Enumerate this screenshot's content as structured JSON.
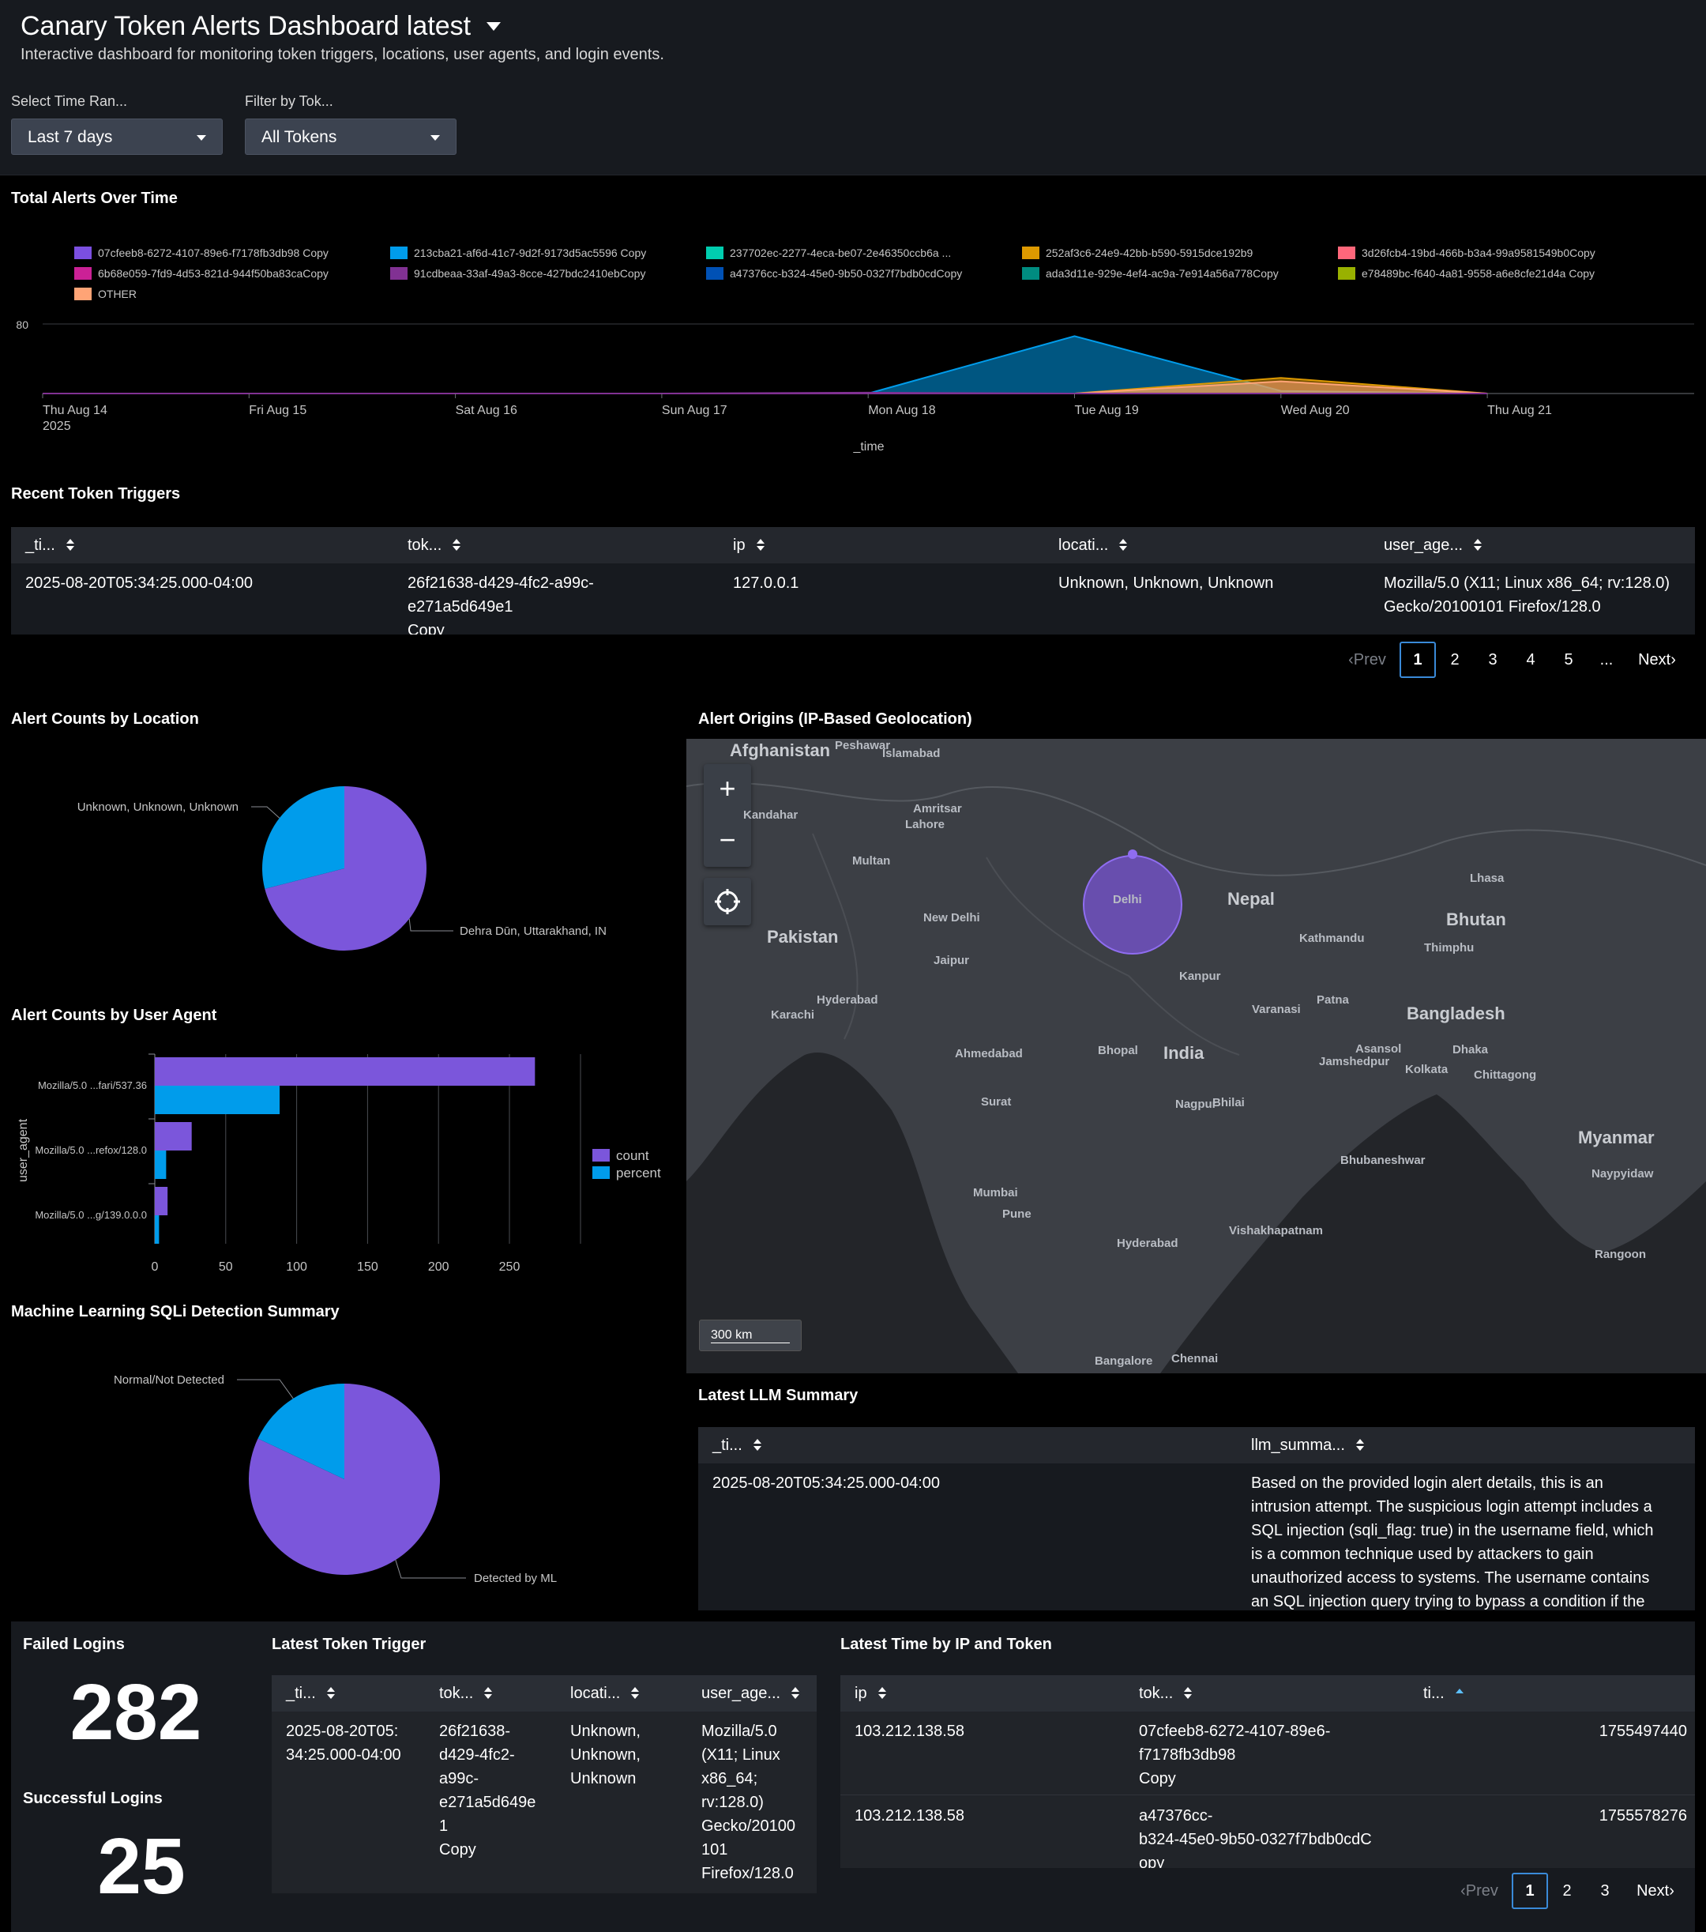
{
  "header": {
    "title": "Canary Token Alerts Dashboard latest",
    "subtitle": "Interactive dashboard for monitoring token triggers, locations, user agents, and login events.",
    "inputs": [
      {
        "label": "Select Time Ran...",
        "value": "Last 7 days"
      },
      {
        "label": "Filter by Tok...",
        "value": "All Tokens"
      }
    ]
  },
  "alerts_over_time": {
    "title": "Total Alerts Over Time",
    "legend": [
      {
        "name": "07cfeeb8-6272-4107-89e6-f7178fb3db98 Copy",
        "color": "#7b4fe0"
      },
      {
        "name": "213cba21-af6d-41c7-9d2f-9173d5ac5596 Copy",
        "color": "#009ceb"
      },
      {
        "name": "237702ec-2277-4eca-be07-2e46350ccb6a ...",
        "color": "#00cdaf"
      },
      {
        "name": "252af3c6-24e9-42bb-b590-5915dce192b9",
        "color": "#dd9900"
      },
      {
        "name": "3d26fcb4-19bd-466b-b3a4-99a9581549b0Copy",
        "color": "#ff677b"
      },
      {
        "name": "6b68e059-7fd9-4d53-821d-944f50ba83caCopy",
        "color": "#cb2196"
      },
      {
        "name": "91cdbeaa-33af-49a3-8cce-427bdc2410ebCopy",
        "color": "#813193"
      },
      {
        "name": "a47376cc-b324-45e0-9b50-0327f7bdb0cdCopy",
        "color": "#0051b5"
      },
      {
        "name": "ada3d11e-929e-4ef4-ac9a-7e914a56a778Copy",
        "color": "#008c80"
      },
      {
        "name": "e78489bc-f640-4a81-9558-a6e8cfe21d4a Copy",
        "color": "#99b100"
      },
      {
        "name": "OTHER",
        "color": "#ffa476"
      }
    ],
    "y_tick": "80",
    "x_ticks": [
      "Thu Aug 14",
      "Fri Aug 15",
      "Sat Aug 16",
      "Sun Aug 17",
      "Mon Aug 18",
      "Tue Aug 19",
      "Wed Aug 20",
      "Thu Aug 21"
    ],
    "x_year": "2025",
    "xlabel": "_time"
  },
  "chart_data": [
    {
      "type": "area",
      "title": "Total Alerts Over Time",
      "xlabel": "_time",
      "x": [
        "2025-08-14",
        "2025-08-15",
        "2025-08-16",
        "2025-08-17",
        "2025-08-18",
        "2025-08-19",
        "2025-08-20",
        "2025-08-21"
      ],
      "ylim": [
        0,
        80
      ],
      "series": [
        {
          "name": "213cba21-af6d-41c7-9d2f-9173d5ac5596 Copy",
          "values": [
            0,
            0,
            0,
            0,
            0,
            66,
            3,
            0
          ]
        },
        {
          "name": "252af3c6-24e9-42bb-b590-5915dce192b9",
          "values": [
            0,
            0,
            0,
            0,
            0,
            0,
            18,
            0
          ]
        },
        {
          "name": "OTHER",
          "values": [
            0,
            0,
            0,
            0,
            0,
            0,
            14,
            0
          ]
        },
        {
          "name": "91cdbeaa-33af-49a3-8cce-427bdc2410ebCopy",
          "values": [
            0,
            0,
            0,
            0,
            1,
            0,
            0,
            0
          ]
        }
      ]
    },
    {
      "type": "pie",
      "title": "Alert Counts by Location",
      "categories": [
        "Dehra Dūn, Uttarakhand, IN",
        "Unknown, Unknown, Unknown"
      ],
      "values": [
        71,
        29
      ],
      "colors": [
        "#7b56db",
        "#009ceb"
      ]
    },
    {
      "type": "bar",
      "title": "Alert Counts by User Agent",
      "ylabel": "user_agent",
      "categories": [
        "Mozilla/5.0 ...fari/537.36",
        "Mozilla/5.0 ...refox/128.0",
        "Mozilla/5.0 ...g/139.0.0.0"
      ],
      "series": [
        {
          "name": "count",
          "values": [
            268,
            26,
            9
          ]
        },
        {
          "name": "percent",
          "values": [
            88,
            8,
            3
          ]
        }
      ],
      "xlim": [
        0,
        300
      ],
      "x_ticks": [
        "0",
        "50",
        "100",
        "150",
        "200",
        "250"
      ]
    },
    {
      "type": "pie",
      "title": "Machine Learning SQLi Detection Summary",
      "categories": [
        "Detected by ML",
        "Normal/Not Detected"
      ],
      "values": [
        82,
        18
      ],
      "colors": [
        "#7b56db",
        "#009ceb"
      ]
    }
  ],
  "recent_triggers": {
    "title": "Recent Token Triggers",
    "columns": [
      "_ti...",
      "tok...",
      "ip",
      "locati...",
      "user_age..."
    ],
    "rows": [
      {
        "time": "2025-08-20T05:34:25.000-04:00",
        "token_l1": "26f21638-d429-4fc2-a99c-",
        "token_l2": "e271a5d649e1",
        "token_l3": "Copy",
        "ip": "127.0.0.1",
        "location": "Unknown, Unknown, Unknown",
        "ua_l1": "Mozilla/5.0 (X11; Linux x86_64; rv:128.0)",
        "ua_l2": "Gecko/20100101 Firefox/128.0"
      }
    ],
    "pager": {
      "prev": "Prev",
      "pages": [
        "1",
        "2",
        "3",
        "4",
        "5",
        "..."
      ],
      "next": "Next"
    }
  },
  "location_panel": {
    "title": "Alert Counts by Location"
  },
  "ua_panel": {
    "title": "Alert Counts by User Agent",
    "legend": [
      "count",
      "percent"
    ]
  },
  "ml_panel": {
    "title": "Machine Learning SQLi Detection Summary"
  },
  "map": {
    "title": "Alert Origins (IP-Based Geolocation)",
    "scale": "300 km",
    "labels": [
      "Afghanistan",
      "Peshawar",
      "Islamabad",
      "Kandahar",
      "Amritsar",
      "Lahore",
      "Multan",
      "Delhi",
      "New Delhi",
      "Nepal",
      "Lhasa",
      "Pakistan",
      "Kathmandu",
      "Bhutan",
      "Thimphu",
      "Jaipur",
      "Kanpur",
      "Hyderabad",
      "Karachi",
      "Varanasi",
      "Patna",
      "Bangladesh",
      "India",
      "Ahmedabad",
      "Bhopal",
      "Asansol",
      "Dhaka",
      "Jamshedpur",
      "Kolkata",
      "Chittagong",
      "Surat",
      "Nagpur",
      "Bhilai",
      "Myanmar",
      "Bhubaneshwar",
      "Naypyidaw",
      "Mumbai",
      "Pune",
      "Hyderabad",
      "Vishakhapatnam",
      "Rangoon",
      "Bangalore",
      "Chennai"
    ]
  },
  "llm": {
    "title": "Latest LLM Summary",
    "columns": [
      "_ti...",
      "llm_summa..."
    ],
    "time": "2025-08-20T05:34:25.000-04:00",
    "summary_lines": [
      "Based on the provided login alert details, this is an",
      "intrusion attempt. The suspicious login attempt includes a",
      "SQL injection (sqli_flag: true) in the username field, which",
      "is a common technique used by attackers to gain",
      "unauthorized access to systems. The username contains",
      "an SQL injection query trying to bypass a condition if the"
    ]
  },
  "failed_logins": {
    "title": "Failed Logins",
    "value": "282"
  },
  "successful_logins": {
    "title": "Successful Logins",
    "value": "25"
  },
  "latest_trigger": {
    "title": "Latest Token Trigger",
    "columns": [
      "_ti...",
      "tok...",
      "locati...",
      "user_age..."
    ],
    "time_lines": [
      "2025-08-20T05:",
      "34:25.000-04:00"
    ],
    "token_lines": [
      "26f21638-",
      "d429-4fc2-",
      "a99c-",
      "e271a5d649e",
      "1",
      "Copy"
    ],
    "location_lines": [
      "Unknown,",
      "Unknown,",
      "Unknown"
    ],
    "ua_lines": [
      "Mozilla/5.0",
      "(X11; Linux",
      "x86_64;",
      "rv:128.0)",
      "Gecko/20100",
      "101",
      "Firefox/128.0"
    ]
  },
  "latest_time": {
    "title": "Latest Time by IP and Token",
    "columns": [
      "ip",
      "tok...",
      "ti..."
    ],
    "rows": [
      {
        "ip": "103.212.138.58",
        "token_lines": [
          "07cfeeb8-6272-4107-89e6-",
          "f7178fb3db98",
          "Copy"
        ],
        "time": "1755497440"
      },
      {
        "ip": "103.212.138.58",
        "token_lines": [
          "a47376cc-",
          "b324-45e0-9b50-0327f7bdb0cdC",
          "opy"
        ],
        "time": "1755578276"
      }
    ],
    "pager": {
      "prev": "Prev",
      "pages": [
        "1",
        "2",
        "3"
      ],
      "next": "Next"
    }
  }
}
